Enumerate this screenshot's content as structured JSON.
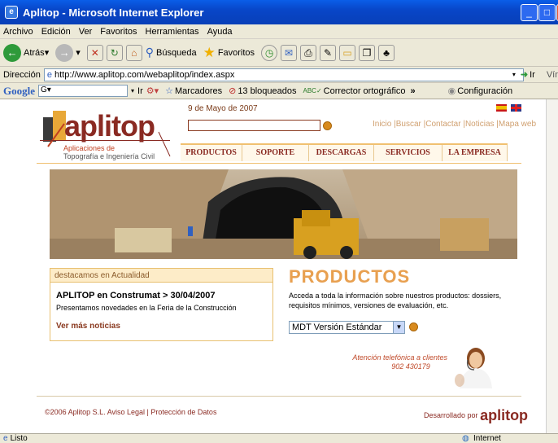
{
  "window": {
    "title": "Aplitop - Microsoft Internet Explorer"
  },
  "menu": [
    "Archivo",
    "Edición",
    "Ver",
    "Favoritos",
    "Herramientas",
    "Ayuda"
  ],
  "toolbar": {
    "back": "Atrás",
    "search": "Búsqueda",
    "favorites": "Favoritos"
  },
  "address": {
    "label": "Dirección",
    "url": "http://www.aplitop.com/webaplitop/index.aspx",
    "go": "Ir",
    "links": "Vínculo"
  },
  "googlebar": {
    "brand": "Google",
    "go": "Ir",
    "bookmarks": "Marcadores",
    "blocked": "13 bloqueados",
    "spell": "Corrector ortográfico",
    "config": "Configuración"
  },
  "status": {
    "text": "Listo",
    "zone": "Internet"
  },
  "site": {
    "logo": "aplitop",
    "sub1": "Aplicaciones de",
    "sub2": "Topografía e Ingeniería Civil",
    "date": "9 de Mayo de 2007",
    "toplinks": "Inicio |Buscar |Contactar |Noticias |Mapa web",
    "nav": [
      "PRODUCTOS",
      "SOPORTE",
      "DESCARGAS",
      "SERVICIOS",
      "LA EMPRESA"
    ],
    "news": {
      "header": "destacamos en Actualidad",
      "title": "APLITOP en Construmat > 30/04/2007",
      "summary": "Presentamos novedades en la Feria de la Construcción",
      "more": "Ver más noticias"
    },
    "products": {
      "title": "PRODUCTOS",
      "text": "Acceda a toda la información sobre nuestros productos: dossiers, requisitos mínimos, versiones de evaluación, etc.",
      "select": "MDT Versión Estándar"
    },
    "phone": {
      "label": "Atención telefónica a clientes",
      "number": "902 430179"
    },
    "footer": {
      "left": "©2006 Aplitop S.L. Aviso Legal | Protección de Datos",
      "right": "Desarrollado por",
      "brand": "aplitop"
    }
  }
}
